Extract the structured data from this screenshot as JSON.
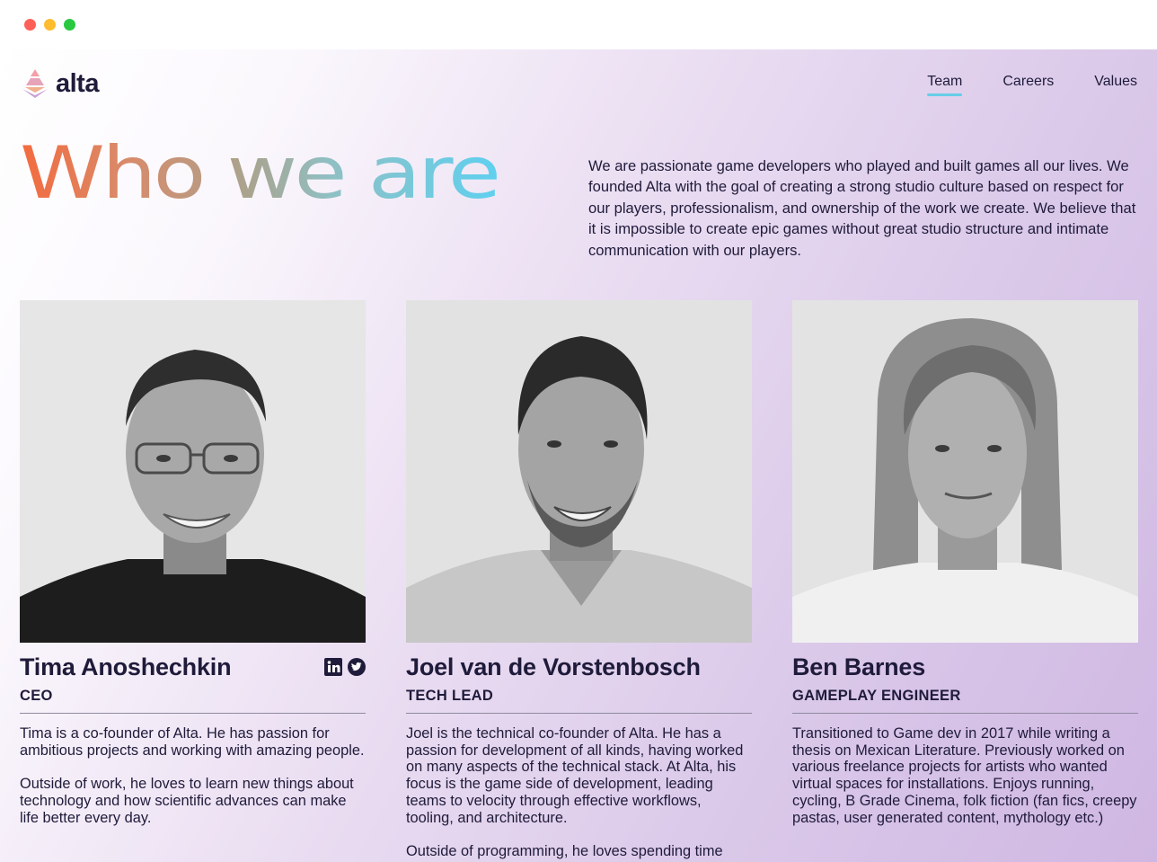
{
  "brand": {
    "name": "alta"
  },
  "nav": {
    "items": [
      {
        "label": "Team"
      },
      {
        "label": "Careers"
      },
      {
        "label": "Values"
      }
    ]
  },
  "hero": {
    "title": "Who we are",
    "description": "We are passionate game developers who played and built games all our lives. We founded Alta with the goal of creating a strong studio culture based on respect for our players, professionalism, and ownership of the work we create. We believe that it is impossible to create epic games without great studio structure and intimate communication with our players."
  },
  "team": [
    {
      "name": "Tima Anoshechkin",
      "role": "CEO",
      "bio": [
        "Tima is a co-founder of Alta. He has passion for ambitious projects and working with amazing people.",
        "Outside of work, he loves to learn new things about technology and how scientific advances can make life better every day."
      ],
      "socials": [
        "linkedin-icon",
        "twitter-icon"
      ]
    },
    {
      "name": "Joel van de Vorstenbosch",
      "role": "TECH LEAD",
      "bio": [
        "Joel is the technical co-founder of Alta. He has a passion for development of all kinds, having worked on many aspects of the technical stack. At Alta, his focus is the game side of development, leading teams to velocity through effective workflows, tooling, and architecture.",
        "Outside of programming, he loves spending time"
      ]
    },
    {
      "name": "Ben Barnes",
      "role": "GAMEPLAY ENGINEER",
      "bio": [
        "Transitioned to Game dev in 2017 while writing a thesis on Mexican Literature. Previously worked on various freelance projects for artists who wanted virtual spaces for installations. Enjoys running, cycling, B Grade Cinema, folk fiction (fan fics, creepy pastas, user generated content, mythology etc.)"
      ]
    }
  ],
  "colors": {
    "accent": "#67cde8",
    "text": "#1f1b3a",
    "title_gradient": [
      "#f36b3e",
      "#a9a48f",
      "#5fd0ef"
    ],
    "background_gradient": [
      "#ffffff",
      "#cfb7e2"
    ]
  }
}
